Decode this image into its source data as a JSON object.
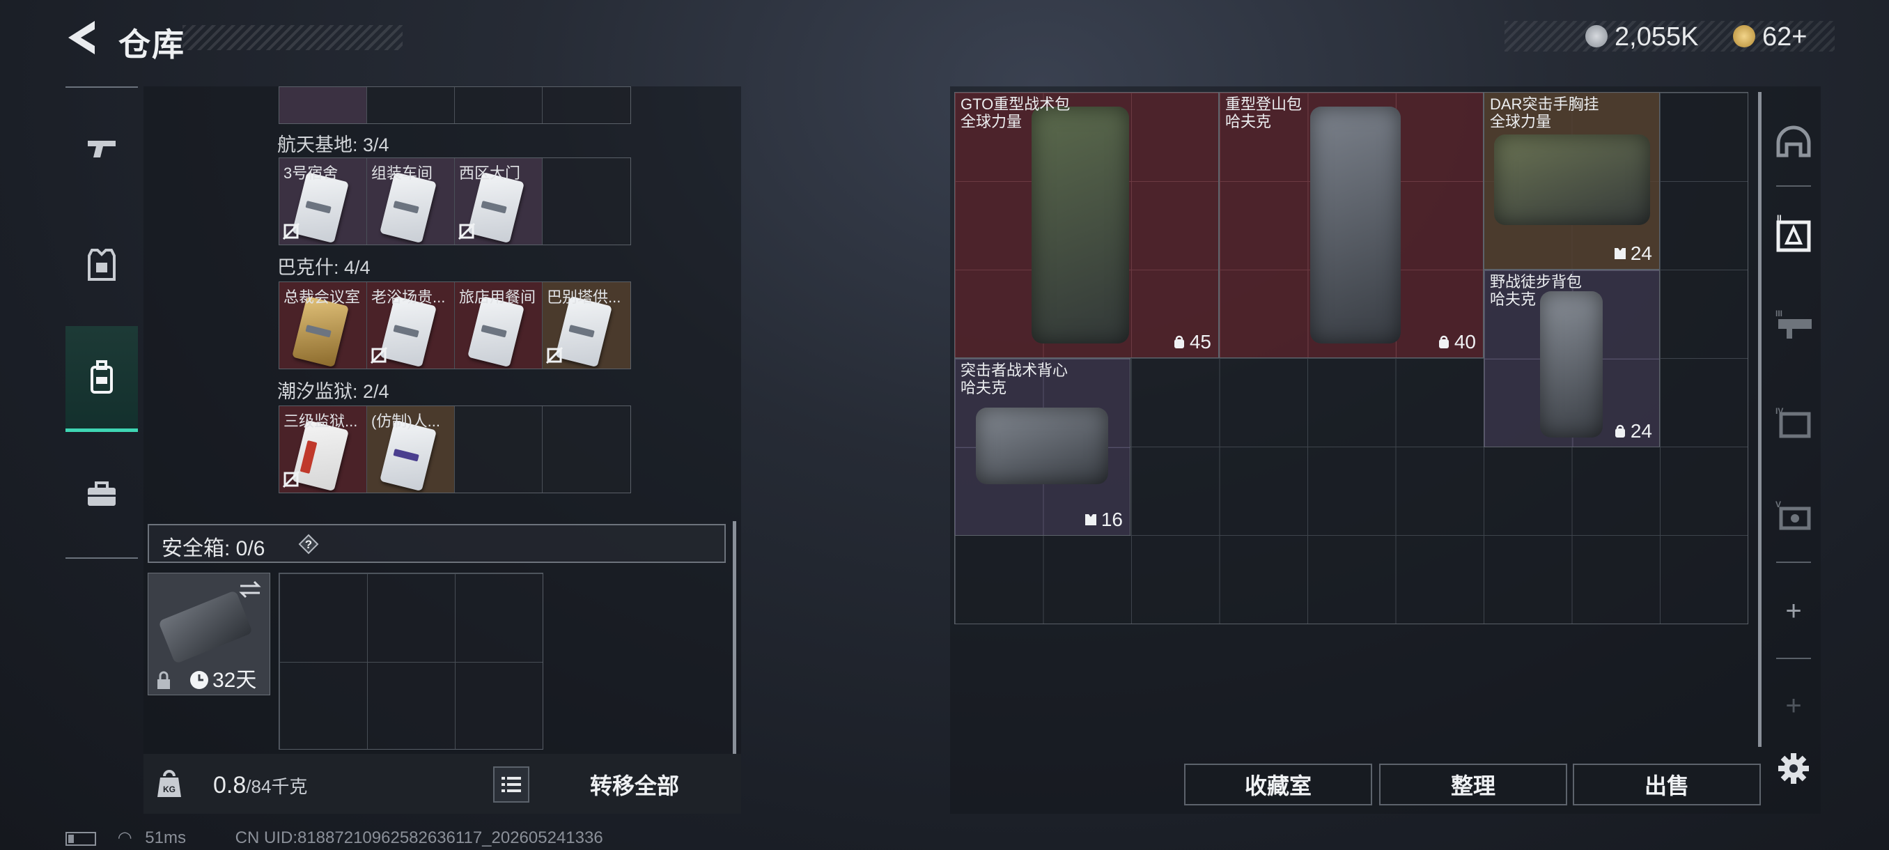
{
  "header": {
    "title": "仓库"
  },
  "currency": [
    {
      "icon": "silver-coin-icon",
      "value": "2,055K"
    },
    {
      "icon": "gold-coin-icon",
      "value": "62+"
    }
  ],
  "left_nav": [
    {
      "name": "weapons",
      "icon": "gun-icon"
    },
    {
      "name": "armor",
      "icon": "armor-icon"
    },
    {
      "name": "backpack",
      "icon": "backpack-icon",
      "active": true
    },
    {
      "name": "toolbox",
      "icon": "toolbox-icon"
    }
  ],
  "key_groups": [
    {
      "label": "航天基地: 3/4",
      "cards": [
        {
          "label": "3号宿舍",
          "style": "purple",
          "card": "white",
          "nosig": true
        },
        {
          "label": "组装车间",
          "style": "purple",
          "card": "white",
          "nosig": false
        },
        {
          "label": "西区大门",
          "style": "purple",
          "card": "white",
          "nosig": true
        },
        {
          "label": "",
          "style": "empty"
        }
      ]
    },
    {
      "label": "巴克什: 4/4",
      "cards": [
        {
          "label": "总裁会议室",
          "style": "red",
          "card": "gold",
          "nosig": false
        },
        {
          "label": "老浴场贵...",
          "style": "red",
          "card": "white",
          "nosig": true
        },
        {
          "label": "旅店用餐间",
          "style": "red",
          "card": "white",
          "nosig": false
        },
        {
          "label": "巴别塔供...",
          "style": "brown",
          "card": "white",
          "nosig": true
        }
      ]
    },
    {
      "label": "潮汐监狱: 2/4",
      "cards": [
        {
          "label": "三级监狱...",
          "style": "red",
          "card": "redc",
          "nosig": true
        },
        {
          "label": "(仿制)人...",
          "style": "brown",
          "card": "purp",
          "nosig": false
        },
        {
          "label": "",
          "style": "empty"
        },
        {
          "label": "",
          "style": "empty"
        }
      ]
    }
  ],
  "safe_box": {
    "label": "安全箱: 0/6",
    "help": "?",
    "item_time": "32天"
  },
  "bottom": {
    "weight": "0.8",
    "weight_max": "/84千克",
    "transfer_all": "转移全部"
  },
  "storage_items": [
    {
      "name": "GTO重型战术包",
      "sub": "全球力量",
      "count": "45",
      "count_icon": "capacity-icon",
      "style": "red",
      "color": "#5b6a4c"
    },
    {
      "name": "重型登山包",
      "sub": "哈夫克",
      "count": "40",
      "count_icon": "capacity-icon",
      "style": "red",
      "color": "#7c828c"
    },
    {
      "name": "DAR突击手胸挂",
      "sub": "全球力量",
      "count": "24",
      "count_icon": "vest-icon",
      "style": "brown",
      "color": "#6b7454"
    },
    {
      "name": "野战徒步背包",
      "sub": "哈夫克",
      "count": "24",
      "count_icon": "capacity-icon",
      "style": "purple",
      "color": "#8a9099"
    },
    {
      "name": "突击者战术背心",
      "sub": "哈夫克",
      "count": "16",
      "count_icon": "vest-icon",
      "style": "purple",
      "color": "#858b94"
    }
  ],
  "actions": {
    "collection": "收藏室",
    "sort": "整理",
    "sell": "出售"
  },
  "right_nav": [
    {
      "icon": "helmet-icon"
    },
    {
      "icon": "storage-ii-icon"
    },
    {
      "icon": "storage-iii-icon"
    },
    {
      "icon": "storage-iv-icon"
    },
    {
      "icon": "storage-v-icon"
    },
    {
      "icon": "add-icon",
      "label": "+"
    },
    {
      "icon": "add-icon",
      "label": "+"
    }
  ],
  "status_bar": {
    "ping": "51ms",
    "uid": "CN UID:81887210962582636117_202605241336"
  }
}
